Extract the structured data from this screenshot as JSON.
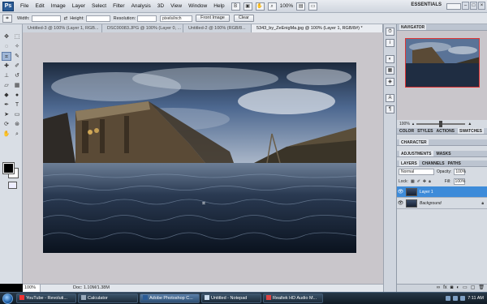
{
  "app": {
    "logo": "Ps"
  },
  "menu": [
    "File",
    "Edit",
    "Image",
    "Layer",
    "Select",
    "Filter",
    "Analysis",
    "3D",
    "View",
    "Window",
    "Help"
  ],
  "menubar": {
    "zoom": "100%",
    "workspace": "ESSENTIALS"
  },
  "options": {
    "width_label": "Width:",
    "height_label": "Height:",
    "resolution_label": "Resolution:",
    "resolution_unit": "pixels/inch",
    "front_image": "Front Image",
    "clear": "Clear"
  },
  "tabs": [
    "Untitled-3 @ 100% (Layer 1, RGB...",
    "DSC00083.JPG @ 100% (Layer 0, ...",
    "Untitled-2 @ 100% (RGB/8...",
    "5343_by_ZeEnigMa.jpg @ 100% (Layer 1, RGB/8#) *"
  ],
  "status": {
    "zoom": "100%",
    "doc": "Doc: 1.10M/1.38M"
  },
  "panels": {
    "navigator": "NAVIGATOR",
    "nav_zoom": "100%",
    "color_tabs": [
      "COLOR",
      "STYLES",
      "ACTIONS",
      "SWATCHES"
    ],
    "character": "CHARACTER",
    "adjustments_tabs": [
      "ADJUSTMENTS",
      "MASKS"
    ],
    "layers_tabs": [
      "LAYERS",
      "CHANNELS",
      "PATHS"
    ],
    "blend_mode": "Normal",
    "opacity_label": "Opacity:",
    "opacity": "100%",
    "lock_label": "Lock:",
    "fill_label": "Fill:",
    "fill": "100%",
    "layers": [
      {
        "name": "Layer 1",
        "active": true
      },
      {
        "name": "Background",
        "active": false
      }
    ]
  },
  "taskbar": {
    "tasks": [
      "YouTube - Revoluti...",
      "Calculator",
      "Adobe Photoshop C...",
      "Untitled - Notepad",
      "Realtek HD Audio M..."
    ],
    "time": "7:11 AM"
  }
}
